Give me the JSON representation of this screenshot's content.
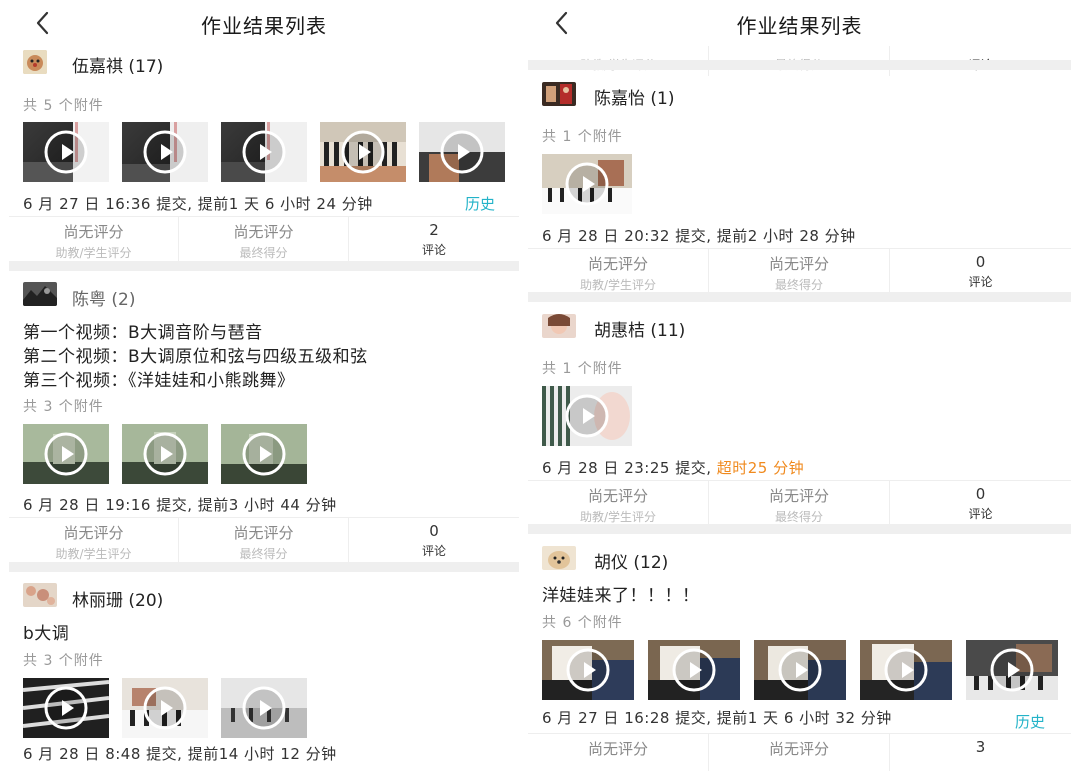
{
  "left": {
    "title": "作业结果列表",
    "students": [
      {
        "name": "伍嘉祺 (17)",
        "lines": [],
        "attachments": "共 5 个附件",
        "submitted": "6 月 27 日 16:36 提交, 提前1 天 6 小时 24 分钟",
        "history": "历史",
        "assist_score": "尚无评分",
        "assist_label": "助教/学生评分",
        "final_score": "尚无评分",
        "final_label": "最终得分",
        "comments": "2",
        "comments_label": "评论"
      },
      {
        "name": "陈粤 (2)",
        "lines": [
          "第一个视频：B大调音阶与琶音",
          "第二个视频：B大调原位和弦与四级五级和弦",
          "第三个视频：《洋娃娃和小熊跳舞》"
        ],
        "attachments": "共 3 个附件",
        "submitted": "6 月 28 日 19:16 提交, 提前3 小时 44 分钟",
        "assist_score": "尚无评分",
        "assist_label": "助教/学生评分",
        "final_score": "尚无评分",
        "final_label": "最终得分",
        "comments": "0",
        "comments_label": "评论"
      },
      {
        "name": "林丽珊 (20)",
        "lines": [
          "b大调"
        ],
        "attachments": "共 3 个附件",
        "submitted": "6 月 28 日 8:48 提交, 提前14 小时 12 分钟"
      }
    ]
  },
  "right": {
    "title": "作业结果列表",
    "top_partial": {
      "assist_label": "助教/学生评分",
      "final_label": "最终得分",
      "comments_label": "评论"
    },
    "students": [
      {
        "name": "陈嘉怡 (1)",
        "attachments": "共 1 个附件",
        "submitted": "6 月 28 日 20:32 提交, 提前2 小时 28 分钟",
        "assist_score": "尚无评分",
        "assist_label": "助教/学生评分",
        "final_score": "尚无评分",
        "final_label": "最终得分",
        "comments": "0",
        "comments_label": "评论"
      },
      {
        "name": "胡惠桔 (11)",
        "attachments": "共 1 个附件",
        "submitted_prefix": "6 月 28 日 23:25 提交, ",
        "submitted_late": "超时25 分钟",
        "assist_score": "尚无评分",
        "assist_label": "助教/学生评分",
        "final_score": "尚无评分",
        "final_label": "最终得分",
        "comments": "0",
        "comments_label": "评论"
      },
      {
        "name": "胡仪 (12)",
        "lines": [
          "洋娃娃来了！！！！"
        ],
        "attachments": "共 6 个附件",
        "submitted": "6 月 27 日 16:28 提交, 提前1 天 6 小时 32 分钟",
        "history": "历史",
        "assist_score": "尚无评分",
        "final_score": "尚无评分",
        "comments": "3"
      }
    ]
  },
  "colors": {
    "history_link": "#23b3c8",
    "late_text": "#f08a1e",
    "section_gap": "#efefef"
  },
  "icons": {
    "back": "chevron-left-icon",
    "play": "play-circle-icon"
  }
}
